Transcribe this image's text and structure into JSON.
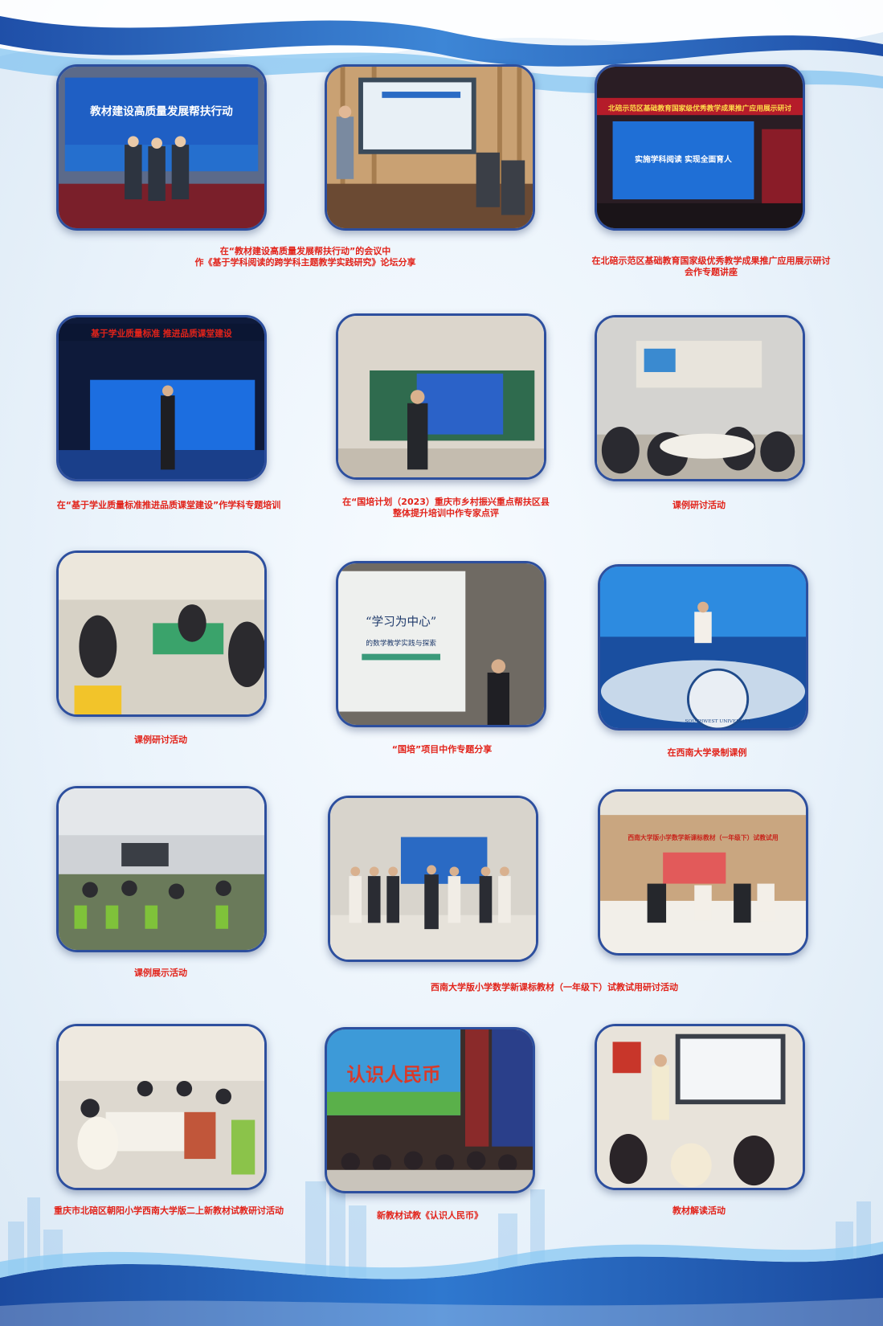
{
  "colors": {
    "caption": "#e2231a",
    "frame": "#2d4f9e",
    "wave_dark": "#1f4fa8",
    "wave_light": "#5fa8e6"
  },
  "photos": [
    {
      "screen_title": "教材建设高质量发展帮扶行动",
      "caption_lines": [
        "在“教材建设高质量发展帮扶行动”的会议中",
        "作《基于学科阅读的跨学科主题教学实践研究》论坛分享"
      ]
    },
    {
      "screen_title": "",
      "caption_lines": []
    },
    {
      "screen_banner": "北碚示范区基础教育国家级优秀教学成果推广应用展示研讨",
      "screen_title": "实施学科阅读  实现全面育人",
      "caption_lines": [
        "在北碚示范区基础教育国家级优秀教学成果推广应用展示研讨",
        "会作专题讲座"
      ]
    },
    {
      "screen_banner": "基于学业质量标准  推进品质课堂建设",
      "caption_lines": [
        "在“基于学业质量标准推进品质课堂建设”作学科专题培训"
      ]
    },
    {
      "caption_lines": [
        "在“国培计划（2023）重庆市乡村振兴重点帮扶区县",
        "整体提升培训中作专家点评"
      ]
    },
    {
      "caption_lines": [
        "课例研讨活动"
      ]
    },
    {
      "caption_lines": [
        "课例研讨活动"
      ]
    },
    {
      "slide_title": "“学习为中心”",
      "slide_subtitle": "的数学教学实践与探索",
      "caption_lines": [
        "“国培”项目中作专题分享"
      ]
    },
    {
      "emblem_text": "SOUTHWEST UNIVERSITY",
      "caption_lines": [
        "在西南大学录制课例"
      ]
    },
    {
      "caption_lines": [
        "课例展示活动"
      ]
    },
    {
      "caption_lines": []
    },
    {
      "screen_banner": "西南大学版小学数学新课标教材（一年级下）试教试用",
      "caption_lines": []
    },
    {
      "caption_lines": [
        "重庆市北碚区朝阳小学西南大学版二上新教材试教研讨活动"
      ]
    },
    {
      "screen_title": "认识人民币",
      "caption_lines": [
        "新教材试教《认识人民币》"
      ]
    },
    {
      "caption_lines": [
        "教材解读活动"
      ]
    }
  ],
  "shared_caption": "西南大学版小学数学新课标教材（一年级下）试教试用研讨活动"
}
